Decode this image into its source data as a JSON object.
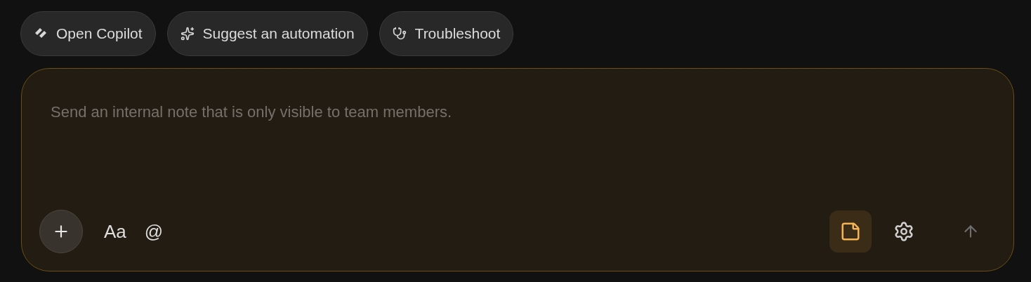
{
  "chips": [
    {
      "kind": "copilot",
      "label": "Open Copilot"
    },
    {
      "kind": "sparkle",
      "label": "Suggest an automation"
    },
    {
      "kind": "stethoscope",
      "label": "Troubleshoot"
    }
  ],
  "composer": {
    "placeholder": "Send an internal note that is only visible to team members.",
    "format_label": "Aa",
    "mention_label": "@",
    "note_mode": {
      "selected": true
    },
    "send": {
      "disabled": true
    }
  }
}
